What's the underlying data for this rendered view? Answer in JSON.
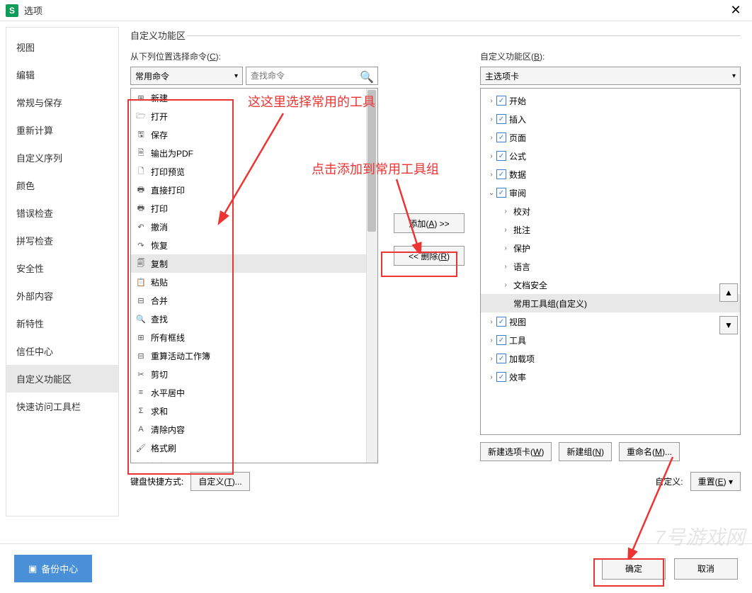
{
  "titlebar": {
    "title": "选项"
  },
  "sidebar": {
    "items": [
      {
        "label": "视图"
      },
      {
        "label": "编辑"
      },
      {
        "label": "常规与保存"
      },
      {
        "label": "重新计算"
      },
      {
        "label": "自定义序列"
      },
      {
        "label": "颜色"
      },
      {
        "label": "错误检查"
      },
      {
        "label": "拼写检查"
      },
      {
        "label": "安全性"
      },
      {
        "label": "外部内容"
      },
      {
        "label": "新特性"
      },
      {
        "label": "信任中心"
      },
      {
        "label": "自定义功能区",
        "active": true
      },
      {
        "label": "快速访问工具栏"
      }
    ]
  },
  "section": {
    "title": "自定义功能区"
  },
  "left": {
    "label_pre": "从下列位置选择命令(",
    "label_u": "C",
    "label_post": "):",
    "dropdown": "常用命令",
    "search_placeholder": "查找命令"
  },
  "commands": [
    {
      "icon": "⊞",
      "label": "新建"
    },
    {
      "icon": "🗁",
      "label": "打开"
    },
    {
      "icon": "🖫",
      "label": "保存"
    },
    {
      "icon": "🗎",
      "label": "输出为PDF"
    },
    {
      "icon": "🗋",
      "label": "打印预览"
    },
    {
      "icon": "🖶",
      "label": "直接打印"
    },
    {
      "icon": "🖶",
      "label": "打印",
      "arrow": true
    },
    {
      "icon": "↶",
      "label": "撤消"
    },
    {
      "icon": "↷",
      "label": "恢复"
    },
    {
      "icon": "🗐",
      "label": "复制",
      "selected": true
    },
    {
      "icon": "📋",
      "label": "粘贴"
    },
    {
      "icon": "⊟",
      "label": "合并",
      "arrow": true
    },
    {
      "icon": "🔍",
      "label": "查找"
    },
    {
      "icon": "⊞",
      "label": "所有框线",
      "arrow": true
    },
    {
      "icon": "⊟",
      "label": "重算活动工作簿"
    },
    {
      "icon": "✂",
      "label": "剪切"
    },
    {
      "icon": "≡",
      "label": "水平居中"
    },
    {
      "icon": "Σ",
      "label": "求和"
    },
    {
      "icon": "A",
      "label": "清除内容"
    },
    {
      "icon": "🖌",
      "label": "格式刷"
    },
    {
      "icon": "B",
      "label": "加粗"
    }
  ],
  "mid": {
    "add_pre": "添加(",
    "add_u": "A",
    "add_post": ") >>",
    "remove_pre": "<< 删除(",
    "remove_u": "R",
    "remove_post": ")"
  },
  "right": {
    "label_pre": "自定义功能区(",
    "label_u": "B",
    "label_post": "):",
    "dropdown": "主选项卡"
  },
  "tree": [
    {
      "level": 1,
      "exp": ">",
      "chk": true,
      "label": "开始"
    },
    {
      "level": 1,
      "exp": ">",
      "chk": true,
      "label": "插入"
    },
    {
      "level": 1,
      "exp": ">",
      "chk": true,
      "label": "页面"
    },
    {
      "level": 1,
      "exp": ">",
      "chk": true,
      "label": "公式"
    },
    {
      "level": 1,
      "exp": ">",
      "chk": true,
      "label": "数据"
    },
    {
      "level": 1,
      "exp": "v",
      "chk": true,
      "label": "审阅"
    },
    {
      "level": 2,
      "exp": ">",
      "label": "校对"
    },
    {
      "level": 2,
      "exp": ">",
      "label": "批注"
    },
    {
      "level": 2,
      "exp": ">",
      "label": "保护"
    },
    {
      "level": 2,
      "exp": ">",
      "label": "语言"
    },
    {
      "level": 2,
      "exp": ">",
      "label": "文档安全"
    },
    {
      "level": 2,
      "exp": "",
      "label": "常用工具组(自定义)",
      "selected": true
    },
    {
      "level": 1,
      "exp": ">",
      "chk": true,
      "label": "视图"
    },
    {
      "level": 1,
      "exp": ">",
      "chk": true,
      "label": "工具"
    },
    {
      "level": 1,
      "exp": ">",
      "chk": true,
      "label": "加载项"
    },
    {
      "level": 1,
      "exp": ">",
      "chk": true,
      "label": "效率"
    }
  ],
  "tree_btns": {
    "newtab_pre": "新建选项卡(",
    "newtab_u": "W",
    "newtab_post": ")",
    "newgroup_pre": "新建组(",
    "newgroup_u": "N",
    "newgroup_post": ")",
    "rename_pre": "重命名(",
    "rename_u": "M",
    "rename_post": ")..."
  },
  "bottom": {
    "shortcut_label": "键盘快捷方式:",
    "customize_pre": "自定义(",
    "customize_u": "T",
    "customize_post": ")...",
    "custom_label": "自定义:",
    "reset_pre": "重置(",
    "reset_u": "E",
    "reset_post": ") ▾"
  },
  "footer": {
    "backup": "备份中心",
    "ok": "确定",
    "cancel": "取消"
  },
  "annotations": {
    "text1": "这这里选择常用的工具",
    "text2": "点击添加到常用工具组"
  }
}
